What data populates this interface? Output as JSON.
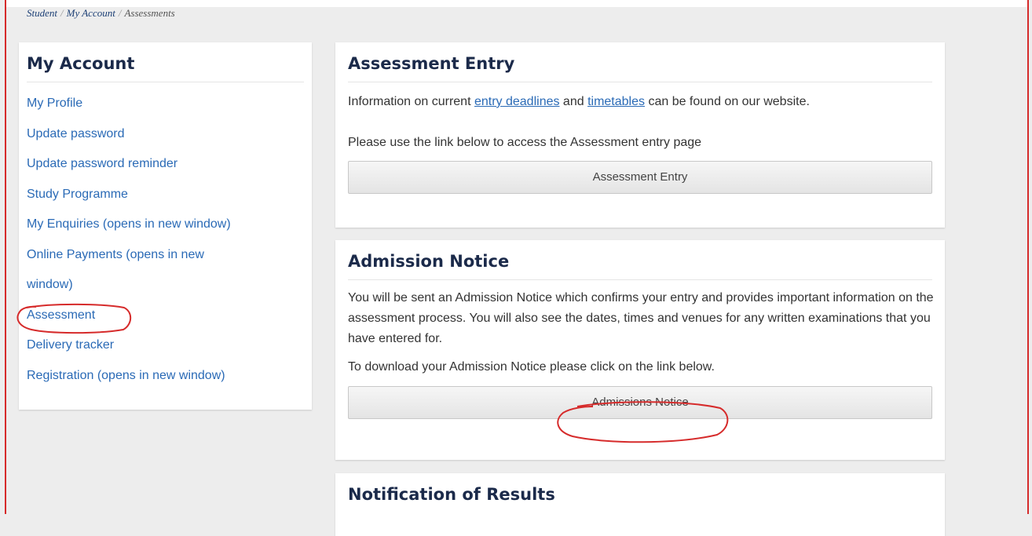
{
  "breadcrumb": {
    "items": [
      "Student",
      "My Account",
      "Assessments"
    ],
    "separator": "/"
  },
  "sidebar": {
    "title": "My Account",
    "items": [
      {
        "label": "My Profile"
      },
      {
        "label": "Update password"
      },
      {
        "label": "Update password reminder"
      },
      {
        "label": "Study Programme"
      },
      {
        "label": "My Enquiries (opens in new window)"
      },
      {
        "label": "Online Payments (opens in new"
      },
      {
        "label": "window)"
      },
      {
        "label": "Assessment"
      },
      {
        "label": "Delivery tracker"
      },
      {
        "label": "Registration (opens in new window)"
      }
    ]
  },
  "assessment_entry": {
    "title": "Assessment Entry",
    "info_prefix": "Information on current ",
    "link_deadlines": "entry deadlines",
    "info_middle": " and ",
    "link_timetables": "timetables",
    "info_suffix": " can be found on our website.",
    "instruction": "Please use the link below to access the Assessment entry page",
    "button_label": "Assessment Entry"
  },
  "admission_notice": {
    "title": "Admission Notice",
    "description": "You will be sent an Admission Notice which confirms your entry and provides important information on the assessment process. You will also see the dates, times and venues for any written examinations that you have entered for.",
    "instruction": "To download your Admission Notice please click on the link below.",
    "button_label": "Admissions Notice"
  },
  "notification_results": {
    "title": "Notification of Results"
  },
  "colors": {
    "link": "#2a6ab6",
    "heading": "#1b2a4a",
    "annotation": "#d62b2b",
    "background": "#ededed"
  }
}
